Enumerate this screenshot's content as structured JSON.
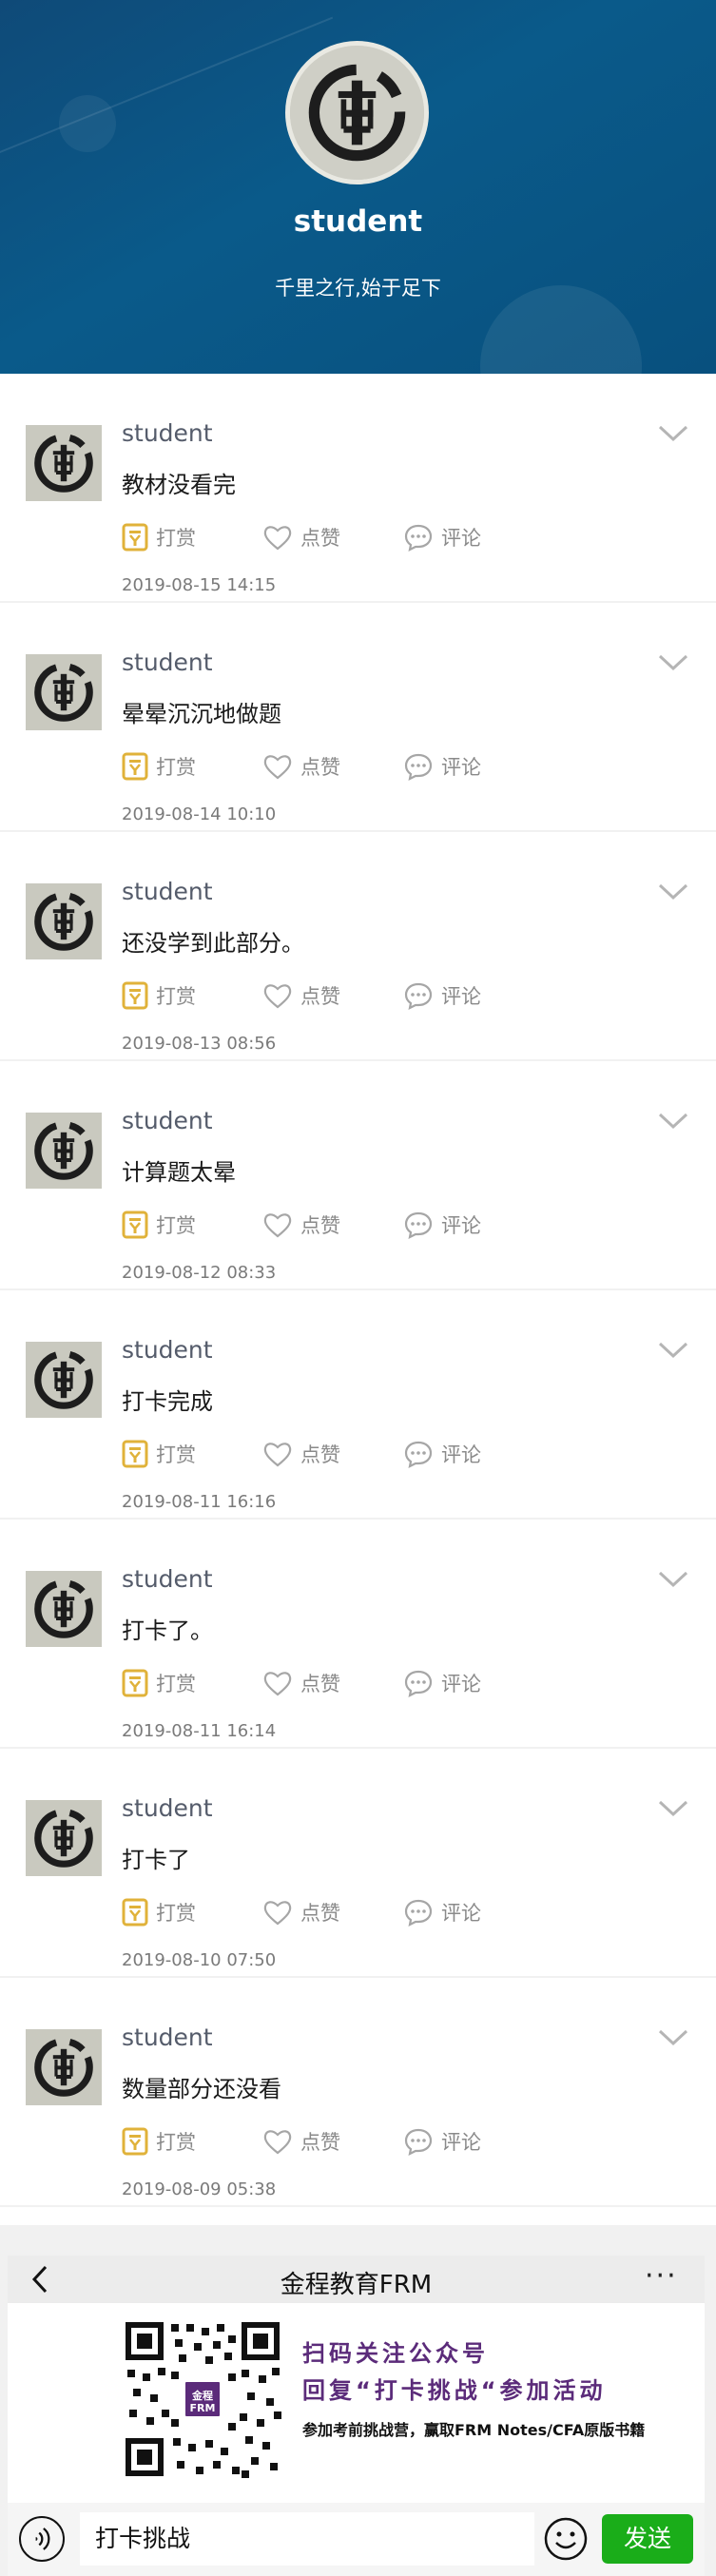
{
  "profile": {
    "name": "student",
    "motto": "千里之行,始于足下"
  },
  "actions": {
    "reward": "打赏",
    "like": "点赞",
    "comment": "评论"
  },
  "posts": [
    {
      "user": "student",
      "text": "教材没看完",
      "time": "2019-08-15 14:15"
    },
    {
      "user": "student",
      "text": "晕晕沉沉地做题",
      "time": "2019-08-14 10:10"
    },
    {
      "user": "student",
      "text": "还没学到此部分。",
      "time": "2019-08-13 08:56"
    },
    {
      "user": "student",
      "text": "计算题太晕",
      "time": "2019-08-12 08:33"
    },
    {
      "user": "student",
      "text": "打卡完成",
      "time": "2019-08-11 16:16"
    },
    {
      "user": "student",
      "text": "打卡了。",
      "time": "2019-08-11 16:14"
    },
    {
      "user": "student",
      "text": "打卡了",
      "time": "2019-08-10 07:50"
    },
    {
      "user": "student",
      "text": "数量部分还没看",
      "time": "2019-08-09 05:38"
    }
  ],
  "wechat": {
    "title": "金程教育FRM",
    "more": "···",
    "qr_logo": "金程 FRM",
    "promo_line1": "扫码关注公众号",
    "promo_line2": "回复“打卡挑战“参加活动",
    "promo_line3": "参加考前挑战营，赢取FRM Notes/CFA原版书籍",
    "input_value": "打卡挑战",
    "send_label": "发送"
  },
  "icons": {
    "reward": "reward-coin-icon",
    "like": "heart-icon",
    "comment": "speech-bubble-icon",
    "expand": "chevron-down-icon"
  },
  "colors": {
    "header_bg": "#0a5a8a",
    "reward_icon": "#e0b23a",
    "promo_accent": "#5b2b7a",
    "send_button": "#1aad19"
  }
}
